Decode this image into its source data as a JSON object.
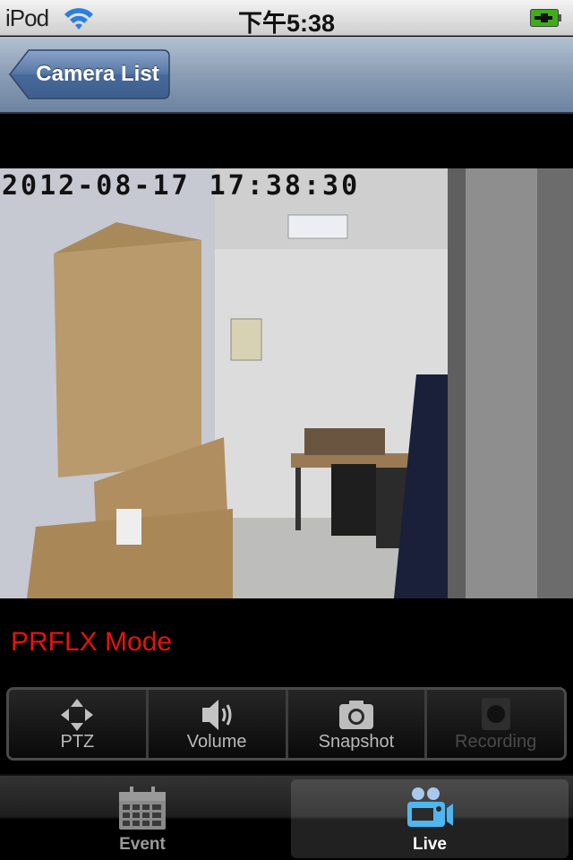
{
  "status_bar": {
    "carrier": "iPod",
    "time": "下午5:38",
    "wifi_icon": "wifi-icon",
    "battery_icon": "battery-charging-icon",
    "battery_color": "#3fae1b"
  },
  "nav_bar": {
    "back_label": "Camera List",
    "back_icon": "back-arrow-button"
  },
  "video": {
    "timestamp": "2012-08-17 17:38:30",
    "description": "live camera feed of office room with cardboard boxes"
  },
  "mode": {
    "label": "PRFLX Mode",
    "color": "#e8120c"
  },
  "toolbar": {
    "buttons": [
      {
        "label": "PTZ",
        "icon": "ptz-arrows-icon",
        "enabled": true
      },
      {
        "label": "Volume",
        "icon": "speaker-icon",
        "enabled": true
      },
      {
        "label": "Snapshot",
        "icon": "camera-icon",
        "enabled": true
      },
      {
        "label": "Recording",
        "icon": "record-icon",
        "enabled": false
      }
    ]
  },
  "tab_bar": {
    "tabs": [
      {
        "label": "Event",
        "icon": "calendar-icon",
        "selected": false
      },
      {
        "label": "Live",
        "icon": "video-camera-icon",
        "selected": true
      }
    ],
    "active_color": "#4fb6f0"
  }
}
